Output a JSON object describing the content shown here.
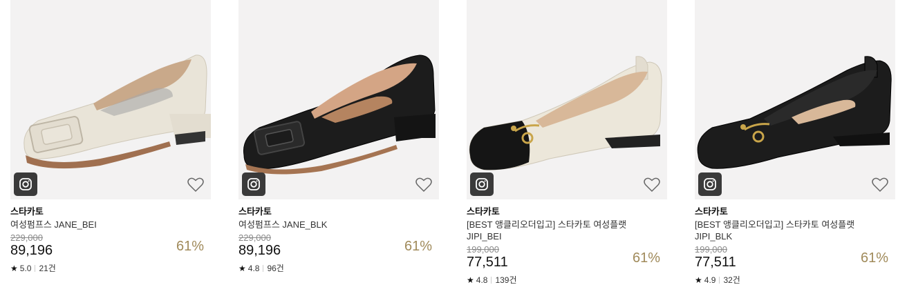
{
  "products": [
    {
      "brand": "스타카토",
      "name": "여성펌프스 JANE_BEI",
      "original_price": "229,000",
      "price": "89,196",
      "discount": "61%",
      "rating": "5.0",
      "reviews": "21건",
      "shoe_color": "#e9e4d8",
      "image_icon": "instagram-icon",
      "wishlist_icon": "heart-icon"
    },
    {
      "brand": "스타카토",
      "name": "여성펌프스 JANE_BLK",
      "original_price": "229,000",
      "price": "89,196",
      "discount": "61%",
      "rating": "4.8",
      "reviews": "96건",
      "shoe_color": "#1c1c1c",
      "image_icon": "instagram-icon",
      "wishlist_icon": "heart-icon"
    },
    {
      "brand": "스타카토",
      "name": "[BEST 앵클리오더입고] 스타카토 여성플랫 JIPI_BEI",
      "original_price": "199,000",
      "price": "77,511",
      "discount": "61%",
      "rating": "4.8",
      "reviews": "139건",
      "shoe_color": "#ece7da",
      "image_icon": "instagram-icon",
      "wishlist_icon": "heart-icon"
    },
    {
      "brand": "스타카토",
      "name": "[BEST 앵클리오더입고] 스타카토 여성플랫 JIPI_BLK",
      "original_price": "199,000",
      "price": "77,511",
      "discount": "61%",
      "rating": "4.9",
      "reviews": "32건",
      "shoe_color": "#1c1c1c",
      "image_icon": "instagram-icon",
      "wishlist_icon": "heart-icon"
    }
  ],
  "colors": {
    "discount": "#a08a5a",
    "original_price": "#8a8a8a",
    "thumb_bg": "#f3f2f2"
  }
}
